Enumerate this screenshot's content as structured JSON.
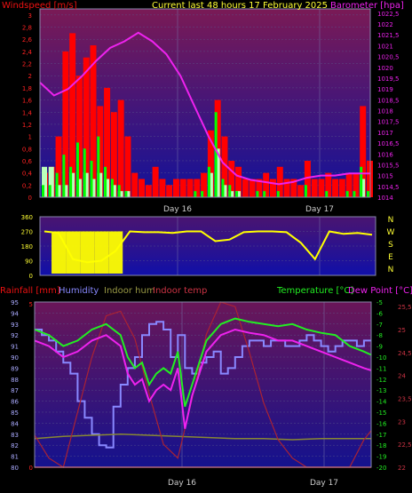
{
  "chart_data": [
    {
      "type": "bar",
      "title": "Current last 48 hours 17 February 2025",
      "ylabel_left": "Windspeed [m/s]",
      "ylabel_right": "Barometer [hpa]",
      "x_tick_labels": [
        "Day 16",
        "Day 17"
      ],
      "y_left_ticks": [
        "0",
        "0,2",
        "0,4",
        "0,6",
        "0,8",
        "1",
        "1,2",
        "1,4",
        "1,6",
        "1,8",
        "2",
        "2,2",
        "2,4",
        "2,6",
        "2,8",
        "3"
      ],
      "y_right_ticks": [
        "1014",
        "1014,5",
        "1015",
        "1015,5",
        "1016",
        "1016,5",
        "1017",
        "1017,5",
        "1018",
        "1018,5",
        "1019",
        "1019,5",
        "1020",
        "1020,5",
        "1021",
        "1021,5",
        "1022",
        "1022,5"
      ],
      "ylim_left": [
        0,
        3.1
      ],
      "ylim_right": [
        1014,
        1022.7
      ],
      "series": [
        {
          "name": "Wind gust",
          "color": "#ff0000",
          "type": "bar",
          "hours": [
            0,
            1,
            2,
            3,
            4,
            5,
            6,
            7,
            8,
            9,
            10,
            11,
            12,
            13,
            14,
            15,
            16,
            17,
            18,
            19,
            20,
            21,
            22,
            23,
            24,
            25,
            26,
            27,
            28,
            29,
            30,
            31,
            32,
            33,
            34,
            35,
            36,
            37,
            38,
            39,
            40,
            41,
            42,
            43,
            44,
            45,
            46,
            47
          ],
          "values": [
            0.4,
            0.5,
            1.0,
            2.4,
            2.7,
            2.0,
            2.3,
            2.5,
            1.5,
            1.8,
            1.4,
            1.6,
            1.0,
            0.4,
            0.3,
            0.2,
            0.5,
            0.3,
            0.2,
            0.3,
            0.3,
            0.3,
            0.3,
            0.4,
            1.1,
            1.6,
            1.0,
            0.6,
            0.5,
            0.3,
            0.3,
            0.3,
            0.4,
            0.3,
            0.5,
            0.3,
            0.3,
            0.2,
            0.6,
            0.3,
            0.3,
            0.4,
            0.3,
            0.3,
            0.4,
            0.4,
            1.5,
            0.6
          ]
        },
        {
          "name": "Windspeed",
          "color": "#00ff00",
          "type": "bar",
          "hours": [
            0,
            1,
            2,
            3,
            4,
            5,
            6,
            7,
            8,
            9,
            10,
            11,
            12,
            13,
            14,
            15,
            16,
            17,
            18,
            19,
            20,
            21,
            22,
            23,
            24,
            25,
            26,
            27,
            28,
            29,
            30,
            31,
            32,
            33,
            34,
            35,
            36,
            37,
            38,
            39,
            40,
            41,
            42,
            43,
            44,
            45,
            46,
            47
          ],
          "values": [
            0.2,
            0.2,
            0.4,
            0.7,
            0.5,
            0.9,
            0.8,
            0.6,
            1.0,
            0.5,
            0.3,
            0.2,
            0.1,
            0.0,
            0.0,
            0.0,
            0.0,
            0.0,
            0.0,
            0.0,
            0.0,
            0.0,
            0.1,
            0.1,
            0.5,
            1.4,
            0.3,
            0.2,
            0.1,
            0.0,
            0.0,
            0.1,
            0.1,
            0.0,
            0.1,
            0.0,
            0.0,
            0.0,
            0.2,
            0.0,
            0.0,
            0.1,
            0.0,
            0.0,
            0.1,
            0.1,
            0.5,
            0.1
          ]
        },
        {
          "name": "Windspeed avg",
          "color": "#bbffbb",
          "type": "bar",
          "hours": [
            0,
            1,
            2,
            3,
            4,
            5,
            6,
            7,
            8,
            9,
            10,
            11,
            12,
            13,
            14,
            15,
            16,
            17,
            18,
            19,
            20,
            21,
            22,
            23,
            24,
            25,
            26,
            27,
            28,
            29,
            30,
            31,
            32,
            33,
            34,
            35,
            36,
            37,
            38,
            39,
            40,
            41,
            42,
            43,
            44,
            45,
            46,
            47
          ],
          "values": [
            0.5,
            0.5,
            0.2,
            0.2,
            0.4,
            0.3,
            0.4,
            0.3,
            0.4,
            0.3,
            0.2,
            0.1,
            0.1,
            0.0,
            0.0,
            0.0,
            0.0,
            0.0,
            0.0,
            0.0,
            0.0,
            0.0,
            0.0,
            0.0,
            0.4,
            0.8,
            0.2,
            0.1,
            0.1,
            0.0,
            0.0,
            0.0,
            0.0,
            0.0,
            0.0,
            0.0,
            0.0,
            0.0,
            0.0,
            0.0,
            0.0,
            0.0,
            0.0,
            0.0,
            0.0,
            0.0,
            0.3,
            0.0
          ]
        },
        {
          "name": "Barometer",
          "color": "#ee22ee",
          "type": "line",
          "axis": "right",
          "hours": [
            0,
            2,
            4,
            6,
            8,
            10,
            12,
            14,
            16,
            18,
            20,
            22,
            24,
            26,
            28,
            30,
            32,
            34,
            36,
            38,
            40,
            42,
            44,
            46,
            47
          ],
          "values": [
            1019.3,
            1018.7,
            1019.0,
            1019.6,
            1020.3,
            1020.9,
            1021.2,
            1021.6,
            1021.2,
            1020.6,
            1019.6,
            1018.2,
            1016.8,
            1015.6,
            1015.0,
            1014.8,
            1014.7,
            1014.6,
            1014.7,
            1014.9,
            1015.0,
            1015.0,
            1015.1,
            1015.1,
            1015.1
          ]
        }
      ]
    },
    {
      "type": "scatter",
      "title": "",
      "ylabel_right": "N W S E N",
      "right_labels": [
        "N",
        "W",
        "S",
        "E",
        "N"
      ],
      "y_ticks": [
        "0",
        "90",
        "180",
        "270",
        "360"
      ],
      "ylim": [
        0,
        360
      ],
      "x_tick_labels": [],
      "series": [
        {
          "name": "Wind direction",
          "color": "#ffff00",
          "hours": [
            0,
            2,
            4,
            6,
            8,
            10,
            12,
            14,
            16,
            18,
            20,
            22,
            24,
            26,
            28,
            30,
            32,
            34,
            36,
            38,
            40,
            42,
            44,
            46
          ],
          "values": [
            270,
            260,
            100,
            80,
            90,
            150,
            270,
            265,
            265,
            260,
            270,
            270,
            210,
            220,
            265,
            270,
            270,
            265,
            200,
            100,
            270,
            255,
            260,
            250
          ]
        }
      ]
    },
    {
      "type": "line",
      "legend": [
        "Rainfall [mm]",
        "Humidity",
        "Indoor hum",
        "Indoor temp",
        "Temperature [°C]",
        "Dew Point [°C]"
      ],
      "x_tick_labels": [
        "Day 16",
        "Day 17"
      ],
      "humidity_ticks": [
        "80",
        "81",
        "82",
        "83",
        "84",
        "85",
        "86",
        "87",
        "88",
        "89",
        "90",
        "91",
        "92",
        "93",
        "94",
        "95"
      ],
      "rain_ticks": [
        "0",
        "5"
      ],
      "temp_ticks": [
        "-20",
        "-19",
        "-18",
        "-17",
        "-16",
        "-15",
        "-14",
        "-13",
        "-12",
        "-11",
        "-10",
        "-9",
        "-8",
        "-7",
        "-6",
        "-5"
      ],
      "indoor_temp_ticks": [
        "22",
        "22,5",
        "23",
        "23,5",
        "24",
        "24,5",
        "25",
        "25,5"
      ],
      "ylim_humidity": [
        80,
        95
      ],
      "ylim_temp": [
        -20,
        -5
      ],
      "ylim_indoor_temp": [
        22,
        25.6
      ],
      "series": [
        {
          "name": "Humidity",
          "color": "#8888ff",
          "axis": "humidity",
          "hours": [
            0,
            1,
            2,
            3,
            4,
            5,
            6,
            7,
            8,
            9,
            10,
            11,
            12,
            13,
            14,
            15,
            16,
            17,
            18,
            19,
            20,
            21,
            22,
            23,
            24,
            25,
            26,
            27,
            28,
            29,
            30,
            31,
            32,
            33,
            34,
            35,
            36,
            37,
            38,
            39,
            40,
            41,
            42,
            43,
            44,
            45,
            46,
            47
          ],
          "values": [
            92.5,
            92.0,
            91.5,
            90.5,
            89.5,
            88.5,
            86.0,
            84.5,
            83.0,
            82.0,
            81.8,
            85.5,
            87.5,
            89.0,
            90.0,
            92.0,
            93.0,
            93.2,
            92.5,
            90.0,
            92.0,
            89.0,
            88.5,
            89.5,
            90.0,
            90.5,
            88.5,
            89.0,
            90.0,
            91.0,
            91.5,
            91.5,
            91.0,
            91.5,
            91.5,
            91.0,
            91.0,
            91.5,
            92.0,
            91.5,
            91.0,
            90.5,
            91.0,
            91.5,
            91.5,
            91.0,
            91.5,
            91.5
          ]
        },
        {
          "name": "Indoor hum",
          "color": "#888833",
          "axis": "humidity",
          "hours": [
            0,
            4,
            8,
            12,
            16,
            20,
            24,
            28,
            32,
            36,
            40,
            44,
            47
          ],
          "values": [
            82.6,
            82.8,
            82.9,
            83.0,
            82.9,
            82.8,
            82.7,
            82.6,
            82.6,
            82.5,
            82.6,
            82.6,
            82.6
          ]
        },
        {
          "name": "Indoor temp",
          "color": "#aa2233",
          "axis": "indoor_temp",
          "hours": [
            0,
            2,
            4,
            6,
            8,
            10,
            12,
            14,
            16,
            18,
            20,
            22,
            24,
            26,
            28,
            30,
            32,
            34,
            36,
            38,
            40,
            42,
            44,
            46,
            47
          ],
          "values": [
            22.7,
            22.2,
            22.0,
            23.2,
            24.4,
            25.3,
            25.4,
            24.8,
            23.6,
            22.5,
            22.2,
            23.5,
            24.9,
            25.6,
            25.5,
            24.5,
            23.4,
            22.6,
            22.2,
            22.0,
            22.0,
            22.0,
            22.0,
            22.6,
            22.8
          ]
        },
        {
          "name": "Temperature [°C]",
          "color": "#22ee22",
          "axis": "temp",
          "hours": [
            0,
            2,
            4,
            6,
            8,
            10,
            12,
            13,
            14,
            15,
            16,
            17,
            18,
            19,
            20,
            21,
            22,
            24,
            26,
            28,
            30,
            32,
            34,
            36,
            38,
            40,
            42,
            44,
            46,
            47
          ],
          "values": [
            -7.5,
            -8.0,
            -9.0,
            -8.5,
            -7.5,
            -7.0,
            -8.0,
            -10.0,
            -11.0,
            -10.5,
            -12.5,
            -11.5,
            -11.0,
            -11.5,
            -9.5,
            -14.5,
            -12.5,
            -8.5,
            -7.0,
            -6.5,
            -6.8,
            -7.0,
            -7.2,
            -7.0,
            -7.5,
            -7.8,
            -8.0,
            -9.0,
            -9.5,
            -9.8
          ]
        },
        {
          "name": "Dew Point [°C]",
          "color": "#ee22ee",
          "axis": "temp",
          "hours": [
            0,
            2,
            4,
            6,
            8,
            10,
            12,
            13,
            14,
            15,
            16,
            17,
            18,
            19,
            20,
            21,
            22,
            24,
            26,
            28,
            30,
            32,
            34,
            36,
            38,
            40,
            42,
            44,
            46,
            47
          ],
          "values": [
            -8.5,
            -9.0,
            -10.0,
            -9.5,
            -8.5,
            -8.0,
            -9.0,
            -11.5,
            -12.5,
            -12.0,
            -14.0,
            -13.0,
            -12.5,
            -13.0,
            -11.0,
            -16.5,
            -13.5,
            -9.5,
            -8.0,
            -7.5,
            -7.8,
            -8.0,
            -8.5,
            -8.5,
            -9.0,
            -9.5,
            -10.0,
            -10.5,
            -11.0,
            -11.2
          ]
        },
        {
          "name": "Rainfall [mm]",
          "color": "#ff2222",
          "axis": "rain",
          "hours": [
            0,
            47
          ],
          "values": [
            0,
            0
          ]
        }
      ]
    }
  ]
}
